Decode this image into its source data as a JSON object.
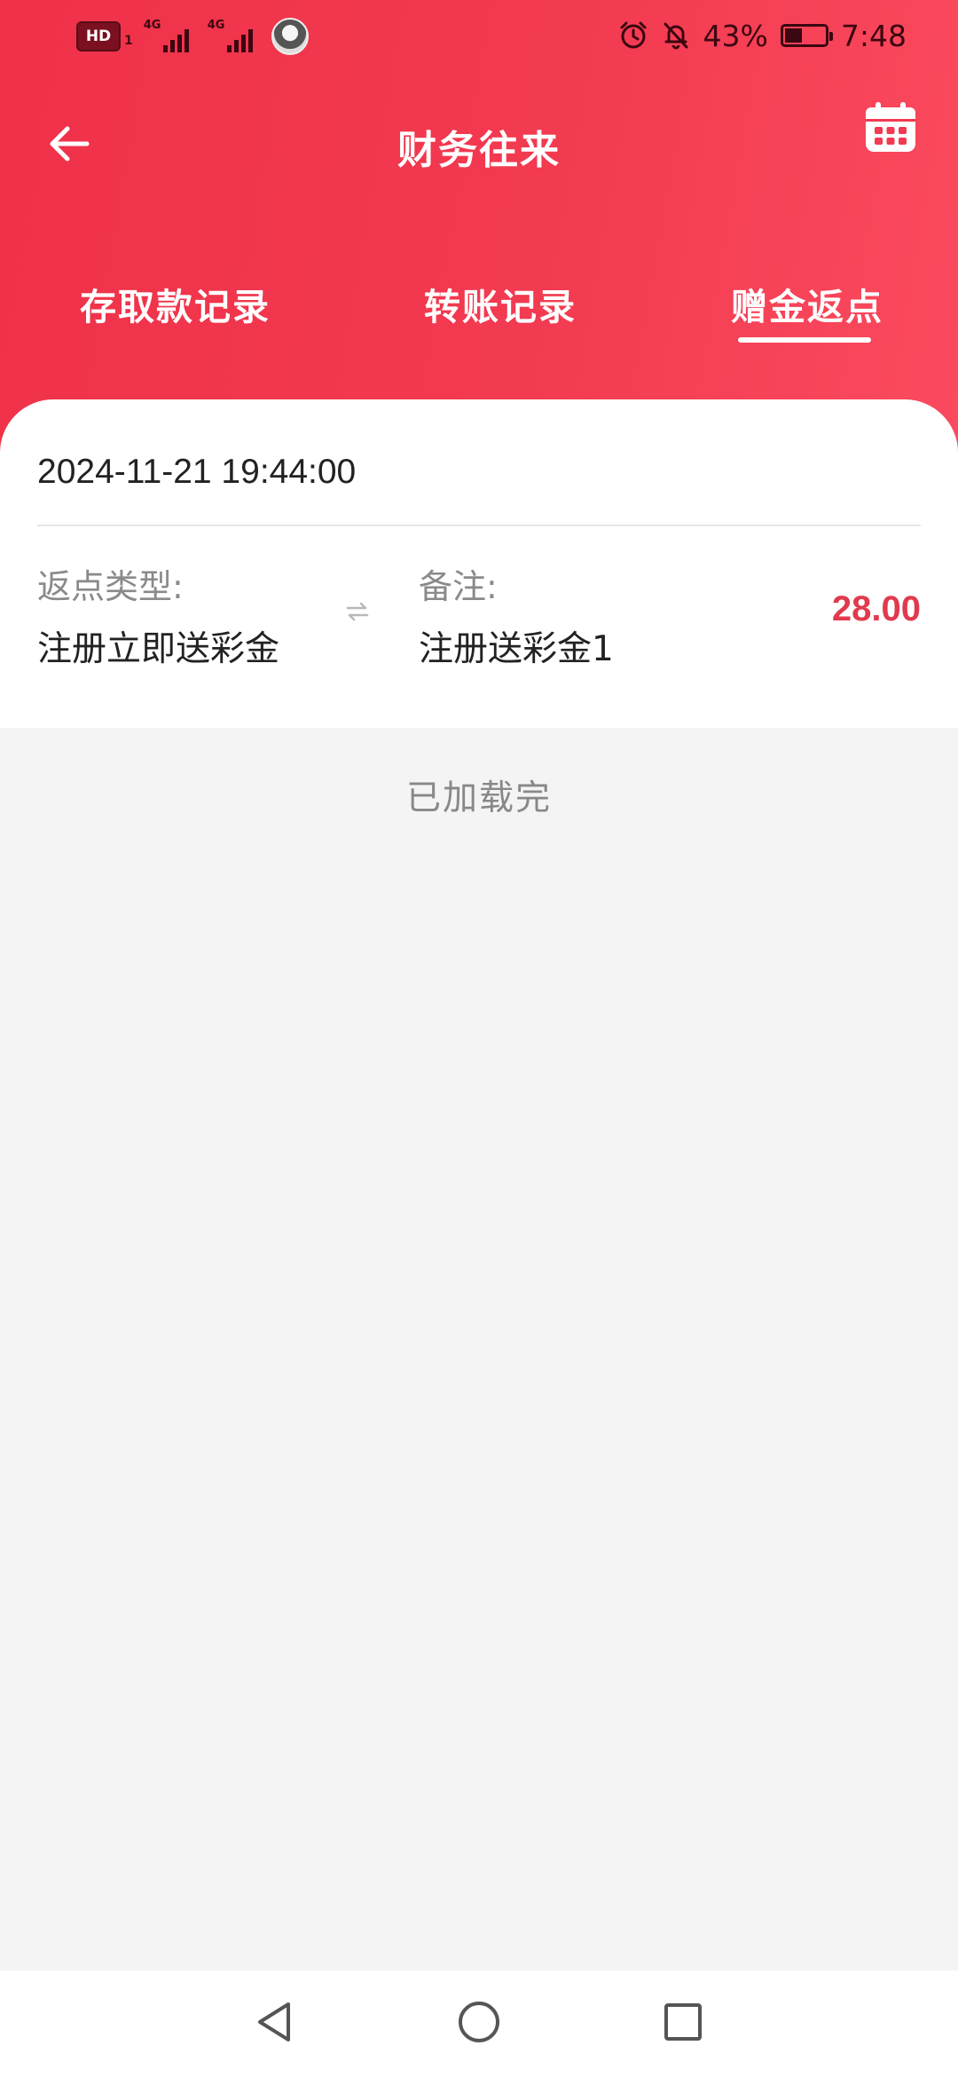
{
  "status_bar": {
    "sim_tag": "HD",
    "sim_sub": "1",
    "network_1": "4G",
    "network_2": "4G",
    "battery_text": "43%",
    "battery_level": 0.43,
    "time": "7:48",
    "icons": [
      "alarm-icon",
      "bell-off-icon",
      "battery-icon"
    ]
  },
  "header": {
    "title": "财务往来",
    "back_icon": "arrow-left-icon",
    "calendar_icon": "calendar-icon"
  },
  "tabs": [
    {
      "label": "存取款记录",
      "active": false
    },
    {
      "label": "转账记录",
      "active": false
    },
    {
      "label": "赠金返点",
      "active": true
    }
  ],
  "records": [
    {
      "date": "2024-11-21 19:44:00",
      "type_label": "返点类型:",
      "type_value": "注册立即送彩金",
      "note_label": "备注:",
      "note_value": "注册送彩金1",
      "amount": "28.00"
    }
  ],
  "list_footer": "已加载完",
  "colors": {
    "brand_red": "#ef3149",
    "amount_red": "#e03a4e",
    "background": "#f4f4f4"
  }
}
